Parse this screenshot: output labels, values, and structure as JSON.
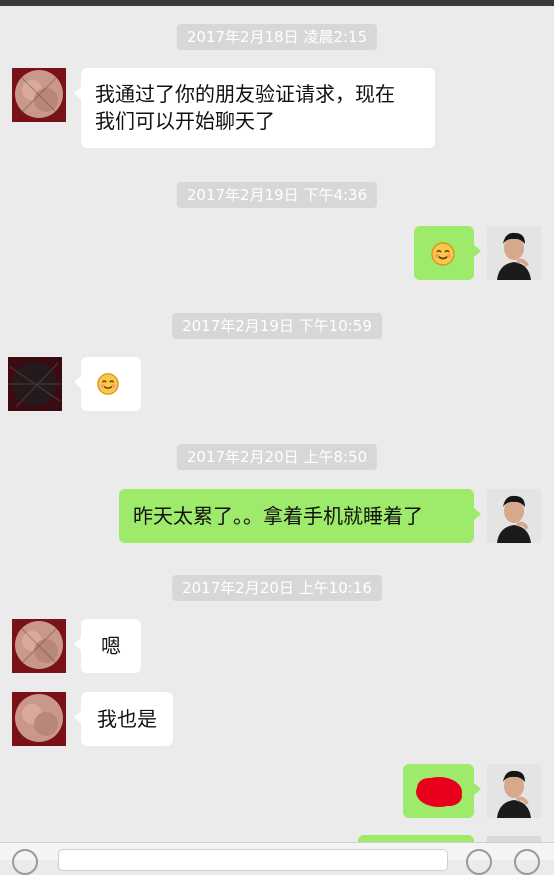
{
  "timestamps": {
    "t1": "2017年2月18日 凌晨2:15",
    "t2": "2017年2月19日 下午4:36",
    "t3": "2017年2月19日 下午10:59",
    "t4": "2017年2月20日 上午8:50",
    "t5": "2017年2月20日 上午10:16"
  },
  "messages": {
    "m1_line1": "我通过了你的朋友验证请求，现在",
    "m1_line2": "我们可以开始聊天了",
    "m2_emoji": "smile-emoji",
    "m3_emoji": "smile-emoji",
    "m4": "昨天太累了。。拿着手机就睡着了",
    "m5": "嗯",
    "m6": "我也是",
    "m7_redacted": "red-redaction-mark"
  },
  "colors": {
    "background": "#ebebeb",
    "timestamp_bg": "#d7d7d7",
    "incoming_bubble": "#ffffff",
    "outgoing_bubble": "#9eea6a",
    "redaction": "#e8001c"
  }
}
